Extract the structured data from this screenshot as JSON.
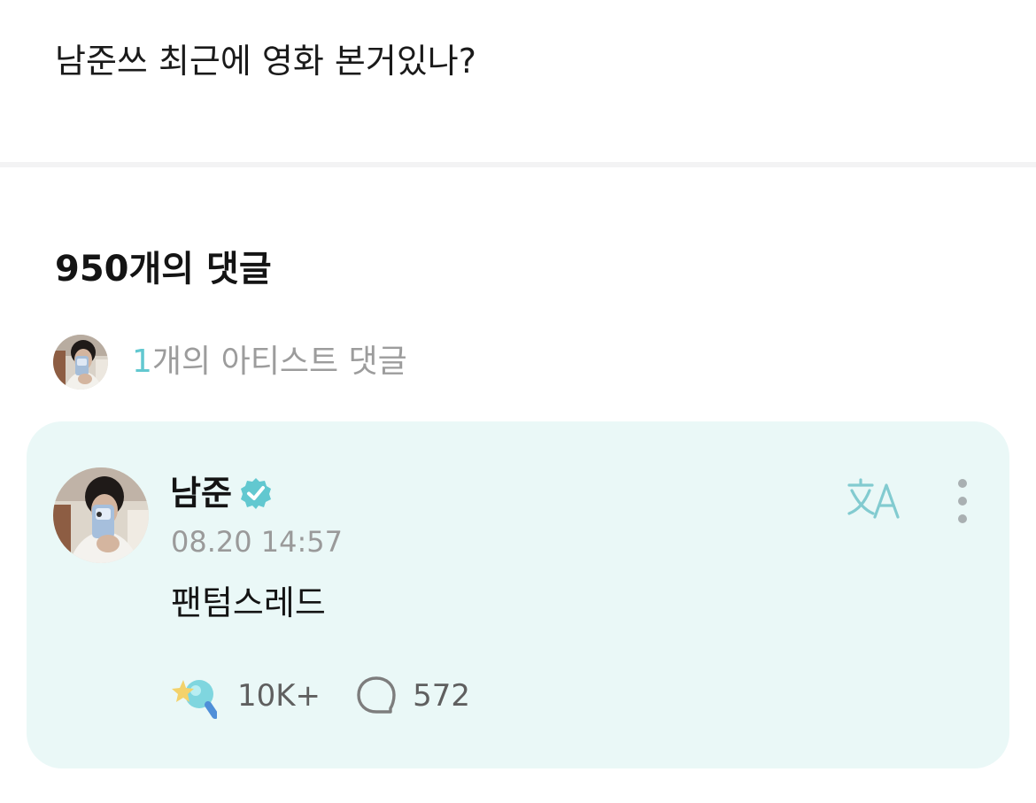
{
  "post": {
    "text": "남준쓰 최근에 영화 본거있나?"
  },
  "comments": {
    "title": "950개의 댓글",
    "artist_summary": {
      "count": "1",
      "label": "개의 아티스트 댓글"
    },
    "items": [
      {
        "author": "남준",
        "verified_icon": "verified-badge-icon",
        "time": "08.20 14:57",
        "body": "팬텀스레드",
        "translate_icon": "translate-icon",
        "more_icon": "more-vertical-icon",
        "like_icon": "star-lightstick-icon",
        "likes": "10K+",
        "reply_icon": "speech-bubble-icon",
        "replies": "572"
      }
    ]
  },
  "colors": {
    "accent": "#62c8d0",
    "card_background": "#eaf8f7",
    "muted_text": "#9a9a9a",
    "primary_text": "#141414"
  }
}
